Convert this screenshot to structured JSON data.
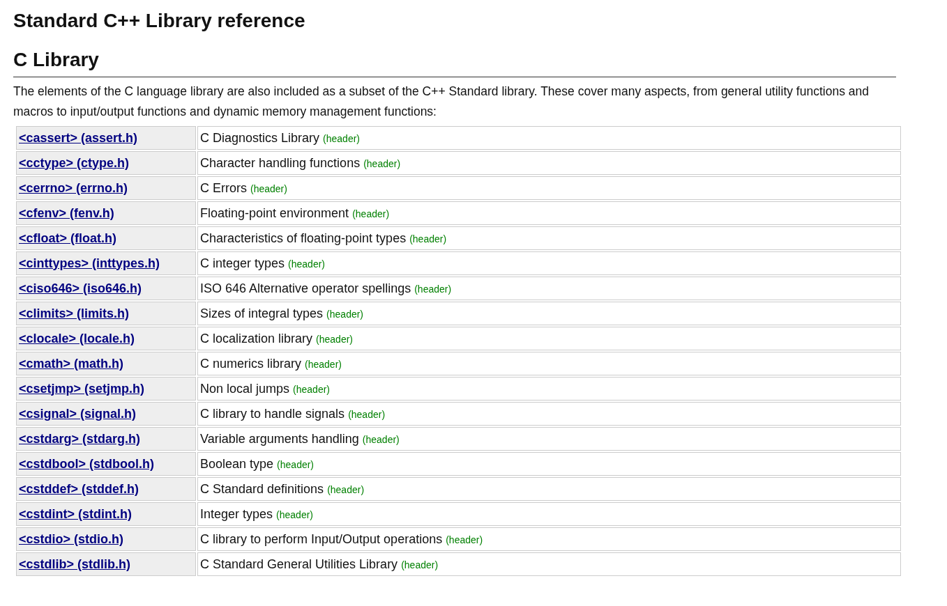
{
  "page_title": "Standard C++ Library reference",
  "section": {
    "heading": "C Library",
    "intro": "The elements of the C language library are also included as a subset of the C++ Standard library. These cover many aspects, from general utility functions and macros to input/output functions and dynamic memory management functions:"
  },
  "rows": [
    {
      "link": "<cassert> (assert.h)",
      "description": "C Diagnostics Library",
      "tag": "(header)"
    },
    {
      "link": "<cctype> (ctype.h)",
      "description": "Character handling functions",
      "tag": "(header)"
    },
    {
      "link": "<cerrno> (errno.h)",
      "description": "C Errors",
      "tag": "(header)"
    },
    {
      "link": "<cfenv> (fenv.h)",
      "description": "Floating-point environment",
      "tag": "(header)"
    },
    {
      "link": "<cfloat> (float.h)",
      "description": "Characteristics of floating-point types",
      "tag": "(header)"
    },
    {
      "link": "<cinttypes> (inttypes.h)",
      "description": "C integer types",
      "tag": "(header)"
    },
    {
      "link": "<ciso646> (iso646.h)",
      "description": "ISO 646 Alternative operator spellings",
      "tag": "(header)"
    },
    {
      "link": "<climits> (limits.h)",
      "description": "Sizes of integral types",
      "tag": "(header)"
    },
    {
      "link": "<clocale> (locale.h)",
      "description": "C localization library",
      "tag": "(header)"
    },
    {
      "link": "<cmath> (math.h)",
      "description": "C numerics library",
      "tag": "(header)"
    },
    {
      "link": "<csetjmp> (setjmp.h)",
      "description": "Non local jumps",
      "tag": "(header)"
    },
    {
      "link": "<csignal> (signal.h)",
      "description": "C library to handle signals",
      "tag": "(header)"
    },
    {
      "link": "<cstdarg> (stdarg.h)",
      "description": "Variable arguments handling",
      "tag": "(header)"
    },
    {
      "link": "<cstdbool> (stdbool.h)",
      "description": "Boolean type",
      "tag": "(header)"
    },
    {
      "link": "<cstddef> (stddef.h)",
      "description": "C Standard definitions",
      "tag": "(header)"
    },
    {
      "link": "<cstdint> (stdint.h)",
      "description": "Integer types",
      "tag": "(header)"
    },
    {
      "link": "<cstdio> (stdio.h)",
      "description": "C library to perform Input/Output operations",
      "tag": "(header)"
    },
    {
      "link": "<cstdlib> (stdlib.h)",
      "description": "C Standard General Utilities Library",
      "tag": "(header)"
    }
  ]
}
